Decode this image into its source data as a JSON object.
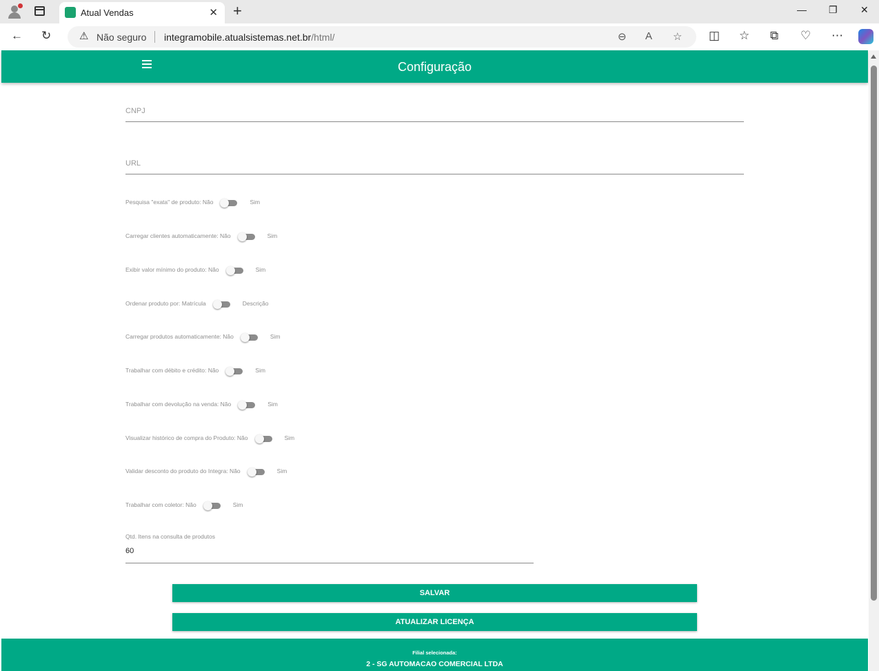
{
  "browser": {
    "tab_title": "Atual Vendas",
    "address_security": "Não seguro",
    "address_host": "integramobile.atualsistemas.net.br",
    "address_path": "/html/"
  },
  "app": {
    "title": "Configuração",
    "accent_color": "#00a986"
  },
  "form": {
    "cnpj_label": "CNPJ",
    "url_label": "URL",
    "toggles": [
      {
        "label": "Pesquisa \"exata\" de produto: Não",
        "on_label": "Sim",
        "checked": false
      },
      {
        "label": "Carregar clientes automaticamente: Não",
        "on_label": "Sim",
        "checked": false
      },
      {
        "label": "Exibir valor mínimo do produto: Não",
        "on_label": "Sim",
        "checked": false
      },
      {
        "label": "Ordenar produto por: Matrícula",
        "on_label": "Descrição",
        "checked": false
      },
      {
        "label": "Carregar produtos automaticamente: Não",
        "on_label": "Sim",
        "checked": false
      },
      {
        "label": "Trabalhar com débito e crédito: Não",
        "on_label": "Sim",
        "checked": false
      },
      {
        "label": "Trabalhar com devolução na venda: Não",
        "on_label": "Sim",
        "checked": false
      },
      {
        "label": "Visualizar histórico de compra do Produto: Não",
        "on_label": "Sim",
        "checked": false
      },
      {
        "label": "Validar desconto do produto do Integra: Não",
        "on_label": "Sim",
        "checked": false
      },
      {
        "label": "Trabalhar com coletor: Não",
        "on_label": "Sim",
        "checked": false
      }
    ],
    "qtd_label": "Qtd. Itens na consulta de produtos",
    "qtd_value": "60",
    "save_button": "SALVAR",
    "license_button": "ATUALIZAR LICENÇA"
  },
  "footer": {
    "label": "Filial selecionada:",
    "branch": "2 - SG AUTOMACAO COMERCIAL LTDA"
  }
}
